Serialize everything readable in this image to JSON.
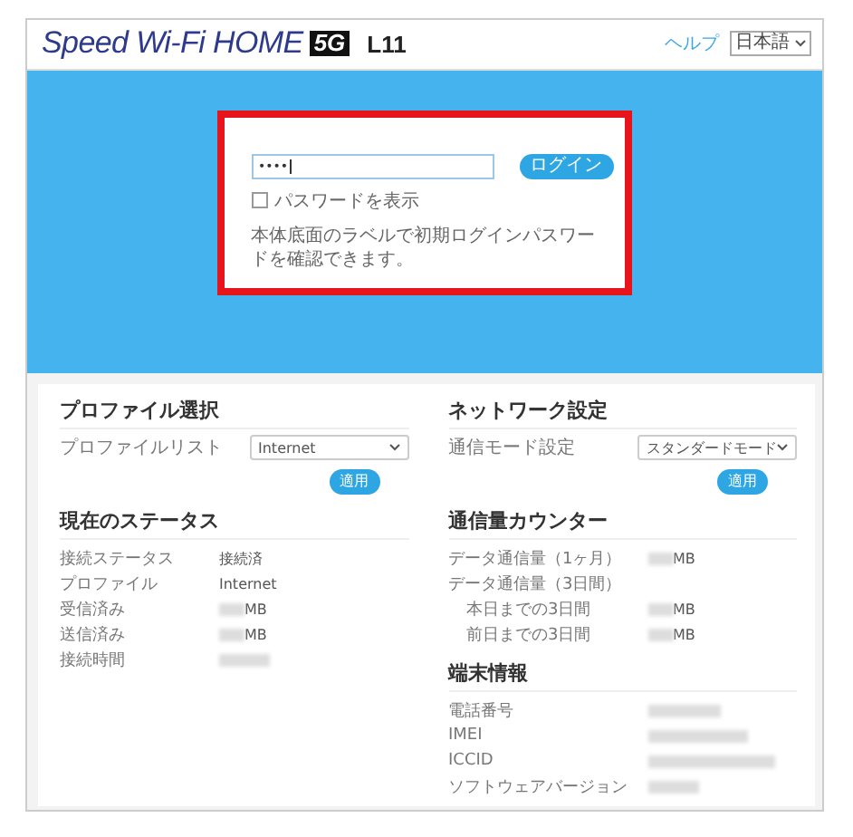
{
  "header": {
    "logo_text": "Speed Wi-Fi HOME",
    "logo_badge": "5G",
    "model": "L11",
    "help": "ヘルプ",
    "language": "日本語"
  },
  "login": {
    "password": "••••",
    "button": "ログイン",
    "show_password": {
      "label": "パスワードを表示",
      "checked": false
    },
    "note": "本体底面のラベルで初期ログインパスワードを確認できます。"
  },
  "columns": [
    {
      "sections": [
        {
          "kind": "select",
          "title": "プロファイル選択",
          "label": "プロファイルリスト",
          "value": "Internet",
          "button": "適用"
        },
        {
          "kind": "list",
          "title": "現在のステータス",
          "rows": [
            {
              "label": "接続ステータス",
              "kind": "text",
              "value": "接続済"
            },
            {
              "label": "プロファイル",
              "kind": "text",
              "value": "Internet"
            },
            {
              "label": "受信済み",
              "kind": "blurred_mb",
              "value": "MB"
            },
            {
              "label": "送信済み",
              "kind": "blurred_mb",
              "value": "MB"
            },
            {
              "label": "接続時間",
              "kind": "blurred_short"
            }
          ]
        }
      ]
    },
    {
      "sections": [
        {
          "kind": "select",
          "title": "ネットワーク設定",
          "label": "通信モード設定",
          "value": "スタンダードモード",
          "button": "適用"
        },
        {
          "kind": "list",
          "title": "通信量カウンター",
          "rows": [
            {
              "label": "データ通信量（1ヶ月）",
              "kind": "blurred_mb",
              "value": "MB"
            },
            {
              "label": "データ通信量（3日間）",
              "kind": "none",
              "children": [
                {
                  "label": "本日までの3日間",
                  "kind": "blurred_mb",
                  "value": "MB"
                },
                {
                  "label": "前日までの3日間",
                  "kind": "blurred_mb",
                  "value": "MB"
                }
              ]
            }
          ]
        },
        {
          "kind": "list",
          "title": "端末情報",
          "rows": [
            {
              "label": "電話番号",
              "kind": "blurred_medium"
            },
            {
              "label": "IMEI",
              "kind": "blurred_long"
            },
            {
              "label": "ICCID",
              "kind": "blurred_xlong"
            },
            {
              "label": "ソフトウェアバージョン",
              "kind": "blurred_short"
            }
          ]
        }
      ]
    }
  ]
}
